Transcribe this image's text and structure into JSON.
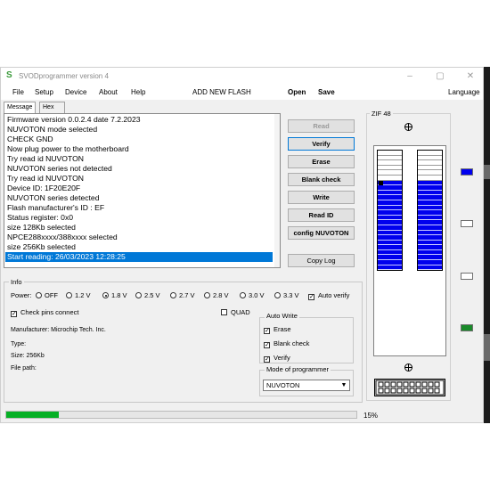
{
  "window": {
    "title": "SVODprogrammer version 4",
    "icon_text": "S",
    "minimize": "–",
    "maximize": "▢",
    "close": "✕"
  },
  "menu": {
    "file": "File",
    "setup": "Setup",
    "device": "Device",
    "about": "About",
    "help": "Help",
    "add_flash": "ADD NEW FLASH",
    "open": "Open",
    "save": "Save",
    "language": "Language"
  },
  "tabs": [
    "Message",
    "Hex Viewer"
  ],
  "messages": [
    "Firmware version 0.0.2.4 date 7.2.2023",
    "NUVOTON mode selected",
    "CHECK GND",
    "Now plug power to the motherboard",
    "Try read id NUVOTON",
    "NUVOTON series not detected",
    "Try read id NUVOTON",
    "Device ID: 1F20E20F",
    "NUVOTON series detected",
    "Flash manufacturer's ID : EF",
    "Status register: 0x0",
    "size 128Kb selected",
    "NPCE288xxxx/388xxxx selected",
    "size 256Kb selected",
    "Start reading: 26/03/2023 12:28:25"
  ],
  "selected_message_index": 14,
  "buttons": {
    "read": "Read",
    "verify": "Verify",
    "erase": "Erase",
    "blank_check": "Blank check",
    "write": "Write",
    "read_id": "Read ID",
    "config": "config NUVOTON",
    "copy_log": "Copy Log"
  },
  "zif": {
    "label": "ZIF 48",
    "pins_per_column": 24,
    "blue_from_pin": 6,
    "leds": [
      "blue",
      "off",
      "off",
      "green"
    ]
  },
  "info": {
    "label": "Info",
    "power_label": "Power:",
    "power_options": [
      "OFF",
      "1.2 V",
      "1.8 V",
      "2.5 V",
      "2.7 V",
      "2.8 V",
      "3.0 V",
      "3.3 V"
    ],
    "power_selected": "1.8 V",
    "auto_verify": {
      "label": "Auto verify",
      "checked": true
    },
    "check_pins": {
      "label": "Check pins connect",
      "checked": true
    },
    "quad": {
      "label": "QUAD",
      "checked": false
    },
    "manufacturer": "Manufacturer: Microchip Tech. Inc.",
    "type": "Type:",
    "size": "Size: 256Kb",
    "file_path": "File path:"
  },
  "auto_write": {
    "label": "Auto Write",
    "erase": {
      "label": "Erase",
      "checked": true
    },
    "blank_check": {
      "label": "Blank check",
      "checked": true
    },
    "verify": {
      "label": "Verify",
      "checked": true
    }
  },
  "mode": {
    "label": "Mode of programmer",
    "value": "NUVOTON"
  },
  "progress": {
    "value": 0.15,
    "text": "15%"
  }
}
